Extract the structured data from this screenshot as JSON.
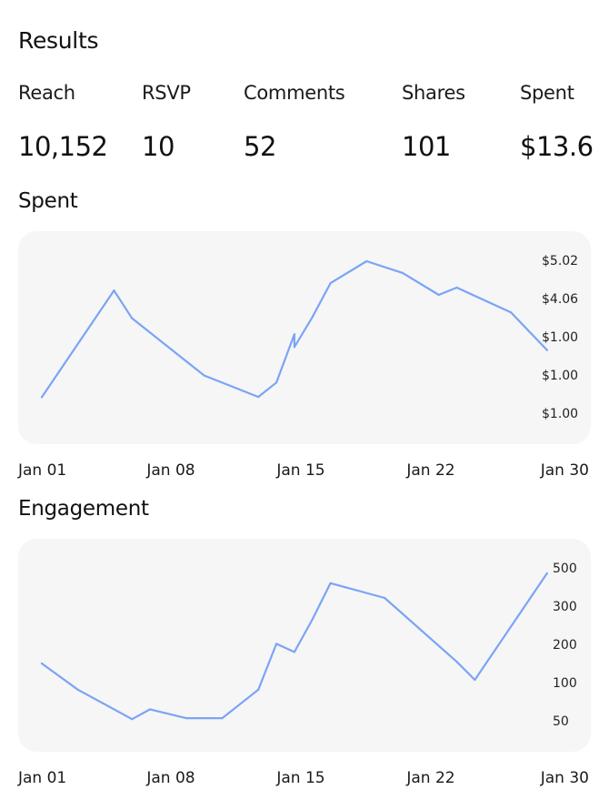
{
  "results": {
    "title": "Results",
    "metrics": [
      {
        "label": "Reach",
        "value": "10,152"
      },
      {
        "label": "RSVP",
        "value": "10"
      },
      {
        "label": "Comments",
        "value": "52"
      },
      {
        "label": "Shares",
        "value": "101"
      },
      {
        "label": "Spent",
        "value": "$13.6"
      }
    ]
  },
  "chart_data": [
    {
      "type": "line",
      "title": "Spent",
      "x_tick_labels": [
        "Jan 01",
        "Jan 08",
        "Jan 15",
        "Jan 22",
        "Jan 30"
      ],
      "y_tick_labels": [
        "$5.02",
        "$4.06",
        "$1.00",
        "$1.00",
        "$1.00"
      ],
      "line_color": "#7ba4f5",
      "background": "#f6f6f6",
      "grid": false,
      "series": [
        {
          "x": [
            "2024-01-01",
            "2024-01-05",
            "2024-01-06",
            "2024-01-10",
            "2024-01-13",
            "2024-01-14",
            "2024-01-15",
            "2024-01-15",
            "2024-01-16",
            "2024-01-17",
            "2024-01-19",
            "2024-01-21",
            "2024-01-23",
            "2024-01-24",
            "2024-01-27",
            "2024-01-29"
          ],
          "y": [
            0.36,
            4.0,
            3.05,
            1.1,
            0.37,
            0.86,
            2.51,
            2.07,
            3.1,
            4.25,
            5.0,
            4.6,
            3.85,
            4.1,
            3.25,
            1.97
          ]
        }
      ]
    },
    {
      "type": "line",
      "title": "Engagement",
      "x_tick_labels": [
        "Jan 01",
        "Jan 08",
        "Jan 15",
        "Jan 22",
        "Jan 30"
      ],
      "y_tick_labels": [
        "500",
        "300",
        "200",
        "100",
        "50"
      ],
      "line_color": "#7ba4f5",
      "background": "#f6f6f6",
      "grid": false,
      "series": [
        {
          "x": [
            "2024-01-01",
            "2024-01-03",
            "2024-01-06",
            "2024-01-07",
            "2024-01-09",
            "2024-01-11",
            "2024-01-13",
            "2024-01-14",
            "2024-01-15",
            "2024-01-16",
            "2024-01-17",
            "2024-01-20",
            "2024-01-24",
            "2024-01-25",
            "2024-01-29"
          ],
          "y": [
            225,
            145,
            55,
            85,
            58,
            58,
            145,
            285,
            260,
            360,
            470,
            425,
            230,
            175,
            500
          ]
        }
      ]
    }
  ]
}
